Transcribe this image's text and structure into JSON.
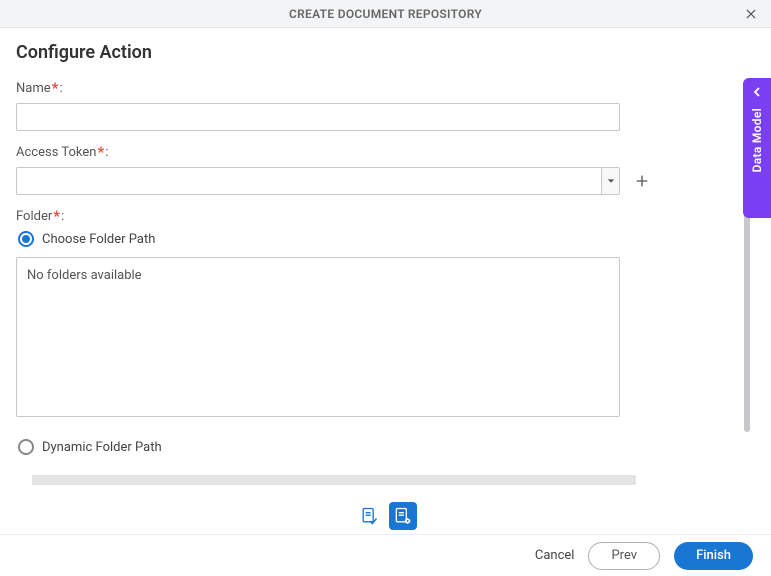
{
  "header": {
    "title": "CREATE DOCUMENT REPOSITORY"
  },
  "section": {
    "title": "Configure Action"
  },
  "fields": {
    "name": {
      "label": "Name ",
      "colon": ":",
      "value": ""
    },
    "access_token": {
      "label": "Access Token ",
      "colon": ":",
      "selected": ""
    },
    "folder": {
      "label": "Folder",
      "colon": ":"
    }
  },
  "radios": {
    "choose_path": "Choose Folder Path",
    "dynamic_path": "Dynamic Folder Path"
  },
  "folder_box": {
    "empty_message": "No folders available"
  },
  "footer": {
    "cancel": "Cancel",
    "prev": "Prev",
    "finish": "Finish"
  },
  "side": {
    "label": "Data Model"
  }
}
